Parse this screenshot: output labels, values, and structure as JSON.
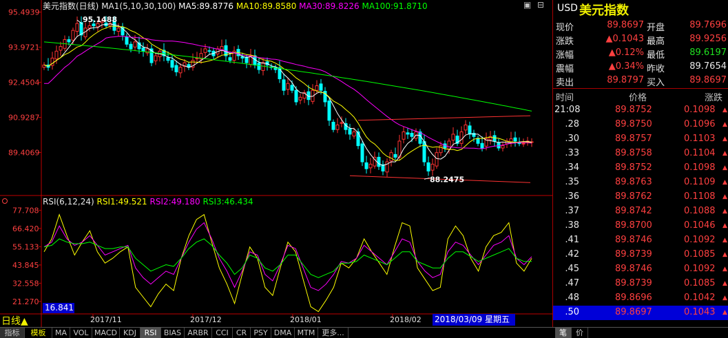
{
  "header": {
    "title": "美元指数(日线)",
    "ma_label": "MA1(5,10,30,100)",
    "ma5": "MA5:89.8776",
    "ma10": "MA10:89.8580",
    "ma30": "MA30:89.8226",
    "ma100": "MA100:91.8710"
  },
  "window_buttons": [
    "▣",
    "⊟"
  ],
  "rsi_header": {
    "label": "RSI(6,12,24)",
    "rsi1": "RSI1:49.521",
    "rsi2": "RSI2:49.180",
    "rsi3": "RSI3:46.434",
    "current_low": "16.841"
  },
  "colors": {
    "up": "#ff3232",
    "down": "#00ffff",
    "ma5": "#ffffff",
    "ma10": "#ffff00",
    "ma30": "#ff00ff",
    "ma100": "#00ff00",
    "rsi1": "#ffff00",
    "rsi2": "#ff00ff",
    "rsi3": "#00ff00",
    "axis": "#c00000",
    "selected": "#0000d0"
  },
  "chart_data": [
    {
      "type": "candlestick",
      "title": "美元指数(日线)",
      "y_ticks": [
        "95.4939",
        "93.9721",
        "92.4504",
        "90.9287",
        "89.4069"
      ],
      "ylim": [
        87.6,
        95.6
      ],
      "x_ticks": [
        "2017/11",
        "2017/12",
        "2018/01",
        "2018/02"
      ],
      "annotations": [
        {
          "text": "95.1488",
          "value": 95.1488,
          "index": 8
        },
        {
          "text": "88.2475",
          "value": 88.2475,
          "index": 92
        }
      ],
      "approx_close": [
        93.2,
        93.1,
        93.5,
        93.8,
        94.0,
        94.3,
        94.2,
        94.7,
        95.0,
        94.5,
        94.8,
        94.9,
        94.9,
        95.0,
        95.1,
        94.9,
        95.0,
        94.7,
        94.8,
        94.5,
        94.1,
        93.9,
        94.2,
        93.9,
        93.8,
        93.9,
        93.3,
        93.6,
        93.8,
        93.6,
        93.4,
        93.1,
        92.9,
        93.1,
        93.3,
        93.1,
        93.4,
        93.5,
        93.7,
        93.9,
        93.8,
        93.6,
        93.9,
        94.0,
        93.6,
        93.4,
        93.8,
        93.6,
        93.5,
        93.3,
        93.6,
        93.2,
        93.0,
        93.3,
        93.2,
        93.1,
        93.0,
        92.6,
        92.1,
        92.4,
        92.1,
        91.6,
        91.8,
        92.0,
        91.7,
        92.1,
        92.3,
        92.1,
        91.6,
        90.8,
        90.4,
        90.6,
        90.7,
        90.4,
        90.2,
        90.3,
        89.7,
        89.0,
        88.7,
        88.9,
        89.2,
        88.8,
        88.6,
        89.0,
        89.4,
        89.2,
        89.9,
        90.3,
        90.2,
        90.1,
        90.3,
        89.8,
        89.0,
        88.6,
        88.9,
        89.4,
        89.7,
        89.6,
        89.9,
        90.2,
        89.8,
        90.3,
        90.6,
        90.2,
        90.1,
        89.8,
        89.6,
        90.0,
        90.1,
        89.9,
        89.6,
        89.7,
        89.9,
        90.0,
        89.9,
        89.8,
        89.8,
        89.9,
        89.87
      ],
      "ma100_approx": [
        94.2,
        91.2
      ],
      "trendlines": [
        {
          "name": "upper",
          "from": [
            90.8,
            91.0
          ]
        },
        {
          "name": "lower",
          "from": [
            88.4,
            88.1
          ]
        }
      ]
    },
    {
      "type": "line",
      "title": "RSI(6,12,24)",
      "y_ticks": [
        "77.708",
        "66.420",
        "55.133",
        "43.845",
        "32.558",
        "21.270"
      ],
      "ylim": [
        14.0,
        80.0
      ],
      "series": [
        {
          "name": "RSI1",
          "values": [
            52,
            60,
            75,
            62,
            50,
            58,
            65,
            52,
            45,
            48,
            52,
            55,
            30,
            24,
            18,
            26,
            32,
            28,
            48,
            62,
            72,
            75,
            58,
            42,
            32,
            20,
            38,
            55,
            48,
            30,
            25,
            42,
            58,
            52,
            35,
            18,
            15,
            22,
            30,
            45,
            42,
            48,
            60,
            52,
            45,
            38,
            55,
            70,
            68,
            42,
            35,
            28,
            30,
            60,
            68,
            62,
            48,
            40,
            55,
            62,
            64,
            70,
            45,
            40,
            48
          ]
        },
        {
          "name": "RSI2",
          "values": [
            55,
            58,
            68,
            60,
            56,
            58,
            62,
            56,
            50,
            52,
            54,
            56,
            42,
            36,
            32,
            36,
            40,
            38,
            48,
            58,
            66,
            70,
            60,
            48,
            40,
            30,
            40,
            52,
            50,
            38,
            34,
            44,
            56,
            54,
            42,
            30,
            28,
            32,
            38,
            46,
            45,
            48,
            56,
            52,
            48,
            44,
            52,
            60,
            58,
            46,
            40,
            36,
            38,
            52,
            58,
            56,
            50,
            44,
            50,
            56,
            58,
            62,
            48,
            44,
            49
          ]
        },
        {
          "name": "RSI3",
          "values": [
            55,
            56,
            60,
            58,
            57,
            57,
            58,
            56,
            54,
            54,
            55,
            55,
            48,
            44,
            40,
            42,
            44,
            43,
            48,
            54,
            58,
            60,
            56,
            50,
            45,
            38,
            42,
            50,
            48,
            42,
            40,
            44,
            50,
            50,
            44,
            38,
            36,
            38,
            40,
            45,
            45,
            46,
            50,
            48,
            46,
            44,
            48,
            52,
            52,
            46,
            44,
            42,
            42,
            48,
            52,
            52,
            49,
            46,
            48,
            50,
            52,
            54,
            48,
            46,
            46
          ]
        }
      ]
    }
  ],
  "quote": {
    "code": "USD",
    "name": "美元指数",
    "rows": [
      {
        "l1": "现价",
        "v1": "89.8697",
        "c1": "red",
        "l2": "开盘",
        "v2": "89.7696",
        "c2": "red"
      },
      {
        "l1": "涨跌",
        "v1": "▲0.1043",
        "c1": "red",
        "l2": "最高",
        "v2": "89.9256",
        "c2": "red"
      },
      {
        "l1": "涨幅",
        "v1": "▲0.12%",
        "c1": "red",
        "l2": "最低",
        "v2": "89.6197",
        "c2": "grn"
      },
      {
        "l1": "震幅",
        "v1": "▲0.34%",
        "c1": "red",
        "l2": "昨收",
        "v2": "89.7654",
        "c2": "wht"
      },
      {
        "l1": "卖出",
        "v1": "89.8797",
        "c1": "red",
        "l2": "买入",
        "v2": "89.8697",
        "c2": "red"
      }
    ],
    "tick_headers": {
      "time": "时间",
      "price": "价格",
      "change": "涨跌"
    },
    "ticks": [
      {
        "t": "21:08",
        "p": "89.8752",
        "c": "0.1098"
      },
      {
        "t": ".28",
        "p": "89.8750",
        "c": "0.1096"
      },
      {
        "t": ".30",
        "p": "89.8757",
        "c": "0.1103"
      },
      {
        "t": ".33",
        "p": "89.8758",
        "c": "0.1104"
      },
      {
        "t": ".34",
        "p": "89.8752",
        "c": "0.1098"
      },
      {
        "t": ".35",
        "p": "89.8763",
        "c": "0.1109"
      },
      {
        "t": ".36",
        "p": "89.8762",
        "c": "0.1108"
      },
      {
        "t": ".37",
        "p": "89.8742",
        "c": "0.1088"
      },
      {
        "t": ".38",
        "p": "89.8700",
        "c": "0.1046"
      },
      {
        "t": ".41",
        "p": "89.8746",
        "c": "0.1092"
      },
      {
        "t": ".42",
        "p": "89.8739",
        "c": "0.1085"
      },
      {
        "t": ".45",
        "p": "89.8746",
        "c": "0.1092"
      },
      {
        "t": ".47",
        "p": "89.8739",
        "c": "0.1085"
      },
      {
        "t": ".48",
        "p": "89.8696",
        "c": "0.1042"
      },
      {
        "t": ".50",
        "p": "89.8697",
        "c": "0.1043"
      }
    ],
    "tick_arrow": "▲"
  },
  "footer": {
    "period": "日线▲",
    "cursor_date": "2018/03/09 星期五",
    "tabs": [
      "指标",
      "模板",
      "MA",
      "VOL",
      "MACD",
      "KDJ",
      "RSI",
      "BIAS",
      "ARBR",
      "CCI",
      "CR",
      "PSY",
      "DMA",
      "MTM",
      "更多..."
    ],
    "active_tab": "RSI",
    "right_tabs": [
      "笔",
      "价"
    ]
  }
}
